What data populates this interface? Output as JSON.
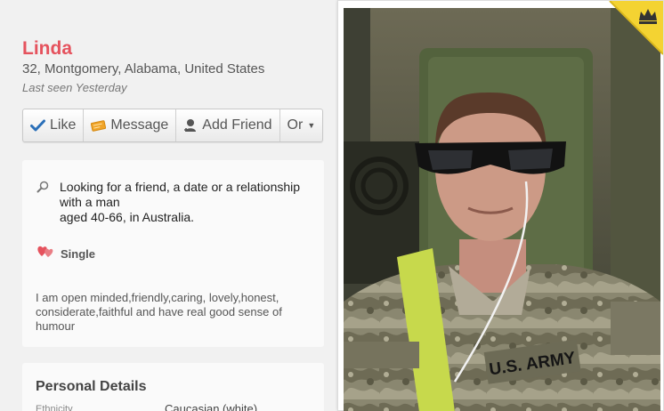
{
  "profile": {
    "name": "Linda",
    "location": "32, Montgomery, Alabama, United States",
    "last_seen": "Last seen Yesterday"
  },
  "actions": {
    "like": "Like",
    "message": "Message",
    "add_friend": "Add Friend",
    "more": "Or"
  },
  "looking_for": {
    "line1": "Looking for a friend, a date or a relationship with a man",
    "line2": "aged 40-66, in Australia."
  },
  "relationship_status": "Single",
  "about": "I am open minded,friendly,caring, lovely,honest, considerate,faithful and have real good sense of humour",
  "personal_details": {
    "title": "Personal Details",
    "rows": [
      {
        "label": "Ethnicity",
        "value": "Caucasian (white)"
      }
    ]
  },
  "photo": {
    "patch_text": "U.S. ARMY",
    "badge_icon": "crown-icon"
  },
  "colors": {
    "name_red": "#e5525d",
    "like_blue": "#2a6fb8",
    "message_orange": "#f0a428",
    "heart_red": "#e5525d",
    "ribbon_gold": "#f4d332"
  }
}
